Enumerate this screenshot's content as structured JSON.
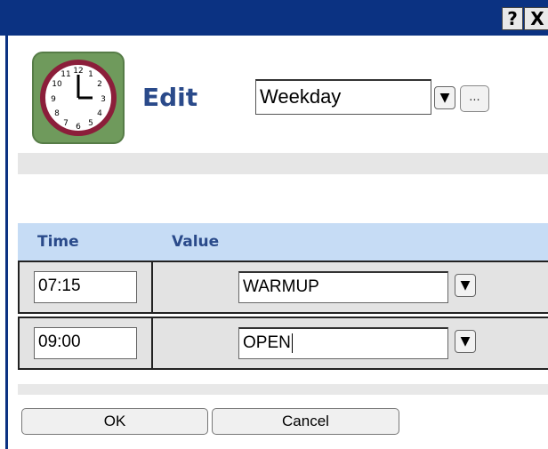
{
  "window": {
    "help_label": "?",
    "close_label": "X",
    "title_bar_color": "#0b3282"
  },
  "header": {
    "icon": "clock-icon",
    "title": "Edit",
    "schedule_value": "Weekday",
    "dropdown_glyph": "▼",
    "ellipsis_label": "..."
  },
  "table": {
    "columns": [
      "Time",
      "Value"
    ],
    "rows": [
      {
        "time": "07:15",
        "value": "WARMUP"
      },
      {
        "time": "09:00",
        "value": "OPEN"
      }
    ]
  },
  "footer": {
    "ok_label": "OK",
    "cancel_label": "Cancel"
  },
  "colors": {
    "header_text": "#2a4a8a",
    "header_row_bg": "#c6dcf5",
    "clock_frame": "#6f9a5c",
    "clock_rim": "#8b1e3a"
  }
}
